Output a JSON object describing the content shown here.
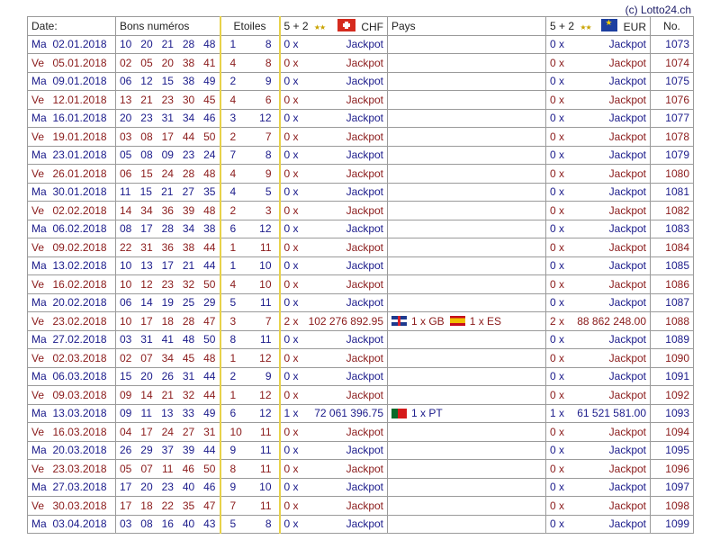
{
  "credit": "(c) Lotto24.ch",
  "header": {
    "date": "Date:",
    "numbers": "Bons numéros",
    "stars": "Etoiles",
    "rank_chf": "5 + 2",
    "currency_chf": "CHF",
    "pays": "Pays",
    "rank_eur": "5 + 2",
    "currency_eur": "EUR",
    "no": "No."
  },
  "rows": [
    {
      "day": "Ma",
      "date": "02.01.2018",
      "nums": [
        "10",
        "20",
        "21",
        "28",
        "48"
      ],
      "stars": [
        "1",
        "8"
      ],
      "chf_count": "0 x",
      "chf_amount": "Jackpot",
      "pays": [],
      "eur_count": "0 x",
      "eur_amount": "Jackpot",
      "no": "1073"
    },
    {
      "day": "Ve",
      "date": "05.01.2018",
      "nums": [
        "02",
        "05",
        "20",
        "38",
        "41"
      ],
      "stars": [
        "4",
        "8"
      ],
      "chf_count": "0 x",
      "chf_amount": "Jackpot",
      "pays": [],
      "eur_count": "0 x",
      "eur_amount": "Jackpot",
      "no": "1074"
    },
    {
      "day": "Ma",
      "date": "09.01.2018",
      "nums": [
        "06",
        "12",
        "15",
        "38",
        "49"
      ],
      "stars": [
        "2",
        "9"
      ],
      "chf_count": "0 x",
      "chf_amount": "Jackpot",
      "pays": [],
      "eur_count": "0 x",
      "eur_amount": "Jackpot",
      "no": "1075"
    },
    {
      "day": "Ve",
      "date": "12.01.2018",
      "nums": [
        "13",
        "21",
        "23",
        "30",
        "45"
      ],
      "stars": [
        "4",
        "6"
      ],
      "chf_count": "0 x",
      "chf_amount": "Jackpot",
      "pays": [],
      "eur_count": "0 x",
      "eur_amount": "Jackpot",
      "no": "1076"
    },
    {
      "day": "Ma",
      "date": "16.01.2018",
      "nums": [
        "20",
        "23",
        "31",
        "34",
        "46"
      ],
      "stars": [
        "3",
        "12"
      ],
      "chf_count": "0 x",
      "chf_amount": "Jackpot",
      "pays": [],
      "eur_count": "0 x",
      "eur_amount": "Jackpot",
      "no": "1077"
    },
    {
      "day": "Ve",
      "date": "19.01.2018",
      "nums": [
        "03",
        "08",
        "17",
        "44",
        "50"
      ],
      "stars": [
        "2",
        "7"
      ],
      "chf_count": "0 x",
      "chf_amount": "Jackpot",
      "pays": [],
      "eur_count": "0 x",
      "eur_amount": "Jackpot",
      "no": "1078"
    },
    {
      "day": "Ma",
      "date": "23.01.2018",
      "nums": [
        "05",
        "08",
        "09",
        "23",
        "24"
      ],
      "stars": [
        "7",
        "8"
      ],
      "chf_count": "0 x",
      "chf_amount": "Jackpot",
      "pays": [],
      "eur_count": "0 x",
      "eur_amount": "Jackpot",
      "no": "1079"
    },
    {
      "day": "Ve",
      "date": "26.01.2018",
      "nums": [
        "06",
        "15",
        "24",
        "28",
        "48"
      ],
      "stars": [
        "4",
        "9"
      ],
      "chf_count": "0 x",
      "chf_amount": "Jackpot",
      "pays": [],
      "eur_count": "0 x",
      "eur_amount": "Jackpot",
      "no": "1080"
    },
    {
      "day": "Ma",
      "date": "30.01.2018",
      "nums": [
        "11",
        "15",
        "21",
        "27",
        "35"
      ],
      "stars": [
        "4",
        "5"
      ],
      "chf_count": "0 x",
      "chf_amount": "Jackpot",
      "pays": [],
      "eur_count": "0 x",
      "eur_amount": "Jackpot",
      "no": "1081"
    },
    {
      "day": "Ve",
      "date": "02.02.2018",
      "nums": [
        "14",
        "34",
        "36",
        "39",
        "48"
      ],
      "stars": [
        "2",
        "3"
      ],
      "chf_count": "0 x",
      "chf_amount": "Jackpot",
      "pays": [],
      "eur_count": "0 x",
      "eur_amount": "Jackpot",
      "no": "1082"
    },
    {
      "day": "Ma",
      "date": "06.02.2018",
      "nums": [
        "08",
        "17",
        "28",
        "34",
        "38"
      ],
      "stars": [
        "6",
        "12"
      ],
      "chf_count": "0 x",
      "chf_amount": "Jackpot",
      "pays": [],
      "eur_count": "0 x",
      "eur_amount": "Jackpot",
      "no": "1083"
    },
    {
      "day": "Ve",
      "date": "09.02.2018",
      "nums": [
        "22",
        "31",
        "36",
        "38",
        "44"
      ],
      "stars": [
        "1",
        "11"
      ],
      "chf_count": "0 x",
      "chf_amount": "Jackpot",
      "pays": [],
      "eur_count": "0 x",
      "eur_amount": "Jackpot",
      "no": "1084"
    },
    {
      "day": "Ma",
      "date": "13.02.2018",
      "nums": [
        "10",
        "13",
        "17",
        "21",
        "44"
      ],
      "stars": [
        "1",
        "10"
      ],
      "chf_count": "0 x",
      "chf_amount": "Jackpot",
      "pays": [],
      "eur_count": "0 x",
      "eur_amount": "Jackpot",
      "no": "1085"
    },
    {
      "day": "Ve",
      "date": "16.02.2018",
      "nums": [
        "10",
        "12",
        "23",
        "32",
        "50"
      ],
      "stars": [
        "4",
        "10"
      ],
      "chf_count": "0 x",
      "chf_amount": "Jackpot",
      "pays": [],
      "eur_count": "0 x",
      "eur_amount": "Jackpot",
      "no": "1086"
    },
    {
      "day": "Ma",
      "date": "20.02.2018",
      "nums": [
        "06",
        "14",
        "19",
        "25",
        "29"
      ],
      "stars": [
        "5",
        "11"
      ],
      "chf_count": "0 x",
      "chf_amount": "Jackpot",
      "pays": [],
      "eur_count": "0 x",
      "eur_amount": "Jackpot",
      "no": "1087"
    },
    {
      "day": "Ve",
      "date": "23.02.2018",
      "nums": [
        "10",
        "17",
        "18",
        "28",
        "47"
      ],
      "stars": [
        "3",
        "7"
      ],
      "chf_count": "2 x",
      "chf_amount": "102 276 892.95",
      "pays": [
        {
          "flag": "gb-flag-icon",
          "text": "1 x GB"
        },
        {
          "flag": "es-flag-icon",
          "text": "1 x ES"
        }
      ],
      "eur_count": "2 x",
      "eur_amount": "88 862 248.00",
      "no": "1088"
    },
    {
      "day": "Ma",
      "date": "27.02.2018",
      "nums": [
        "03",
        "31",
        "41",
        "48",
        "50"
      ],
      "stars": [
        "8",
        "11"
      ],
      "chf_count": "0 x",
      "chf_amount": "Jackpot",
      "pays": [],
      "eur_count": "0 x",
      "eur_amount": "Jackpot",
      "no": "1089"
    },
    {
      "day": "Ve",
      "date": "02.03.2018",
      "nums": [
        "02",
        "07",
        "34",
        "45",
        "48"
      ],
      "stars": [
        "1",
        "12"
      ],
      "chf_count": "0 x",
      "chf_amount": "Jackpot",
      "pays": [],
      "eur_count": "0 x",
      "eur_amount": "Jackpot",
      "no": "1090"
    },
    {
      "day": "Ma",
      "date": "06.03.2018",
      "nums": [
        "15",
        "20",
        "26",
        "31",
        "44"
      ],
      "stars": [
        "2",
        "9"
      ],
      "chf_count": "0 x",
      "chf_amount": "Jackpot",
      "pays": [],
      "eur_count": "0 x",
      "eur_amount": "Jackpot",
      "no": "1091"
    },
    {
      "day": "Ve",
      "date": "09.03.2018",
      "nums": [
        "09",
        "14",
        "21",
        "32",
        "44"
      ],
      "stars": [
        "1",
        "12"
      ],
      "chf_count": "0 x",
      "chf_amount": "Jackpot",
      "pays": [],
      "eur_count": "0 x",
      "eur_amount": "Jackpot",
      "no": "1092"
    },
    {
      "day": "Ma",
      "date": "13.03.2018",
      "nums": [
        "09",
        "11",
        "13",
        "33",
        "49"
      ],
      "stars": [
        "6",
        "12"
      ],
      "chf_count": "1 x",
      "chf_amount": "72 061 396.75",
      "pays": [
        {
          "flag": "pt-flag-icon",
          "text": "1 x PT"
        }
      ],
      "eur_count": "1 x",
      "eur_amount": "61 521 581.00",
      "no": "1093"
    },
    {
      "day": "Ve",
      "date": "16.03.2018",
      "nums": [
        "04",
        "17",
        "24",
        "27",
        "31"
      ],
      "stars": [
        "10",
        "11"
      ],
      "chf_count": "0 x",
      "chf_amount": "Jackpot",
      "pays": [],
      "eur_count": "0 x",
      "eur_amount": "Jackpot",
      "no": "1094"
    },
    {
      "day": "Ma",
      "date": "20.03.2018",
      "nums": [
        "26",
        "29",
        "37",
        "39",
        "44"
      ],
      "stars": [
        "9",
        "11"
      ],
      "chf_count": "0 x",
      "chf_amount": "Jackpot",
      "pays": [],
      "eur_count": "0 x",
      "eur_amount": "Jackpot",
      "no": "1095"
    },
    {
      "day": "Ve",
      "date": "23.03.2018",
      "nums": [
        "05",
        "07",
        "11",
        "46",
        "50"
      ],
      "stars": [
        "8",
        "11"
      ],
      "chf_count": "0 x",
      "chf_amount": "Jackpot",
      "pays": [],
      "eur_count": "0 x",
      "eur_amount": "Jackpot",
      "no": "1096"
    },
    {
      "day": "Ma",
      "date": "27.03.2018",
      "nums": [
        "17",
        "20",
        "23",
        "40",
        "46"
      ],
      "stars": [
        "9",
        "10"
      ],
      "chf_count": "0 x",
      "chf_amount": "Jackpot",
      "pays": [],
      "eur_count": "0 x",
      "eur_amount": "Jackpot",
      "no": "1097"
    },
    {
      "day": "Ve",
      "date": "30.03.2018",
      "nums": [
        "17",
        "18",
        "22",
        "35",
        "47"
      ],
      "stars": [
        "7",
        "11"
      ],
      "chf_count": "0 x",
      "chf_amount": "Jackpot",
      "pays": [],
      "eur_count": "0 x",
      "eur_amount": "Jackpot",
      "no": "1098"
    },
    {
      "day": "Ma",
      "date": "03.04.2018",
      "nums": [
        "03",
        "08",
        "16",
        "40",
        "43"
      ],
      "stars": [
        "5",
        "8"
      ],
      "chf_count": "0 x",
      "chf_amount": "Jackpot",
      "pays": [],
      "eur_count": "0 x",
      "eur_amount": "Jackpot",
      "no": "1099"
    }
  ],
  "icons": {
    "chf_flag": "swiss-flag-icon",
    "eur_flag": "eu-flag-icon",
    "stars": "two-stars-icon"
  },
  "colors": {
    "odd_row_text": "#1a1a8a",
    "even_row_text": "#8a1a1a",
    "stars_border": "#e8d24a"
  }
}
